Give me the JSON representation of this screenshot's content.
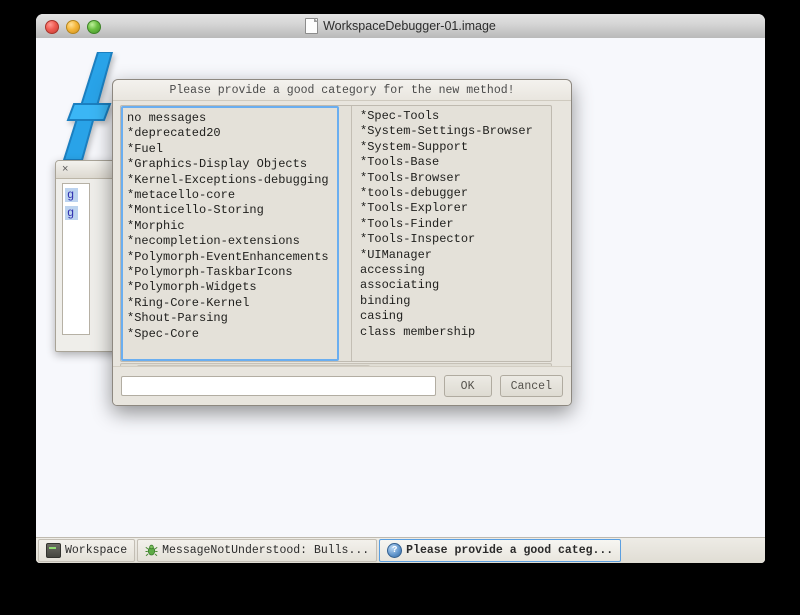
{
  "window": {
    "title": "WorkspaceDebugger-01.image",
    "doc_icon": "document-icon",
    "lights": [
      "close-light",
      "minimize-light",
      "zoom-light"
    ]
  },
  "background_window": {
    "close_label": "×",
    "snippets": [
      "g",
      "g"
    ]
  },
  "dialog": {
    "prompt": "Please provide a good category for the new method!",
    "left_list": [
      "no messages",
      "*deprecated20",
      "*Fuel",
      "*Graphics-Display Objects",
      "*Kernel-Exceptions-debugging",
      "*metacello-core",
      "*Monticello-Storing",
      "*Morphic",
      "*necompletion-extensions",
      "*Polymorph-EventEnhancements",
      "*Polymorph-TaskbarIcons",
      "*Polymorph-Widgets",
      "*Ring-Core-Kernel",
      "*Shout-Parsing",
      "*Spec-Core"
    ],
    "right_list": [
      "*Spec-Tools",
      "*System-Settings-Browser",
      "*System-Support",
      "*Tools-Base",
      "*Tools-Browser",
      "*tools-debugger",
      "*Tools-Explorer",
      "*Tools-Finder",
      "*Tools-Inspector",
      "*UIManager",
      "accessing",
      "associating",
      "binding",
      "casing",
      "class membership"
    ],
    "scrollbar": {
      "left_arrow": "‹",
      "right_arrow": "›",
      "thumb_percent": 58
    },
    "input": {
      "value": "",
      "placeholder": ""
    },
    "ok_label": "OK",
    "cancel_label": "Cancel"
  },
  "taskbar": {
    "items": [
      {
        "label": "Workspace",
        "icon": "workspace-icon",
        "active": false
      },
      {
        "label": "MessageNotUnderstood: Bulls...",
        "icon": "bug-icon",
        "active": false
      },
      {
        "label": "Please provide a good categ...",
        "icon": "question-mark-icon",
        "active": true
      }
    ]
  },
  "colors": {
    "desktop": "#f7f8fc",
    "dialog_bg": "#e8e5de",
    "focus_blue": "#6aaef0",
    "logo_blue": "#29a3e8"
  }
}
